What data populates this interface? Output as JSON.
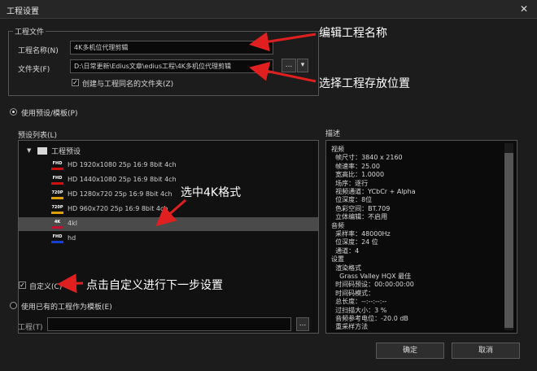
{
  "window": {
    "title": "工程设置",
    "close_glyph": "✕"
  },
  "project_file": {
    "group_label": "工程文件",
    "name_label": "工程名称(N)",
    "name_value": "4K多机位代理剪辑",
    "folder_label": "文件夹(F)",
    "folder_value": "D:\\日常更新\\Edius文章\\edius工程\\4K多机位代理剪辑",
    "browse_label": "...",
    "dropdown_glyph": "▾",
    "create_folder_label": "创建与工程同名的文件夹(Z)",
    "create_folder_checked": true
  },
  "preset_mode": {
    "use_preset_label": "使用预设/模板(P)",
    "selected": true
  },
  "preset_list": {
    "label": "预设列表(L)",
    "root_label": "工程预设",
    "items": [
      {
        "badge": "FHD",
        "bar": "#d01010",
        "text": "HD 1920x1080 25p 16:9 8bit 4ch"
      },
      {
        "badge": "FHD",
        "bar": "#d01010",
        "text": "HD 1440x1080 25p 16:9 8bit 4ch"
      },
      {
        "badge": "720P",
        "bar": "#e0a000",
        "text": "HD 1280x720 25p 16:9 8bit 4ch"
      },
      {
        "badge": "720P",
        "bar": "#e0a000",
        "text": "HD 960x720 25p 16:9 8bit 4ch"
      },
      {
        "badge": "4K",
        "bar": "#c01030",
        "text": "4kl"
      },
      {
        "badge": "FHD",
        "bar": "#1840d0",
        "text": "hd"
      }
    ]
  },
  "description": {
    "label": "描述",
    "lines": [
      "视频",
      "  帧尺寸：3840 x 2160",
      "  帧速率：25.00",
      "  宽高比：1.0000",
      "  场序：逐行",
      "  视频通道：YCbCr + Alpha",
      "  位深度：8位",
      "  色彩空间：BT.709",
      "  立体编辑：不启用",
      "音频",
      "  采样率：48000Hz",
      "  位深度：24 位",
      "  通道：4",
      "设置",
      "  渲染格式",
      "    Grass Valley HQX 最佳",
      "  时间码预设：00:00:00:00",
      "  时间码模式：",
      "  总长度：--:--:--:--",
      "  过扫描大小：3 %",
      "  音频参考电位：-20.0 dB",
      "  重采样方法"
    ]
  },
  "custom": {
    "label": "自定义(C)",
    "checked": true
  },
  "template_mode": {
    "label": "使用已有的工程作为模板(E)",
    "project_label": "工程(T)",
    "browse_label": "..."
  },
  "buttons": {
    "ok": "确定",
    "cancel": "取消"
  },
  "annotations": {
    "edit_name": "编辑工程名称",
    "choose_location": "选择工程存放位置",
    "select_4k": "选中4K格式",
    "click_custom": "点击自定义进行下一步设置",
    "color": "#e02020"
  }
}
